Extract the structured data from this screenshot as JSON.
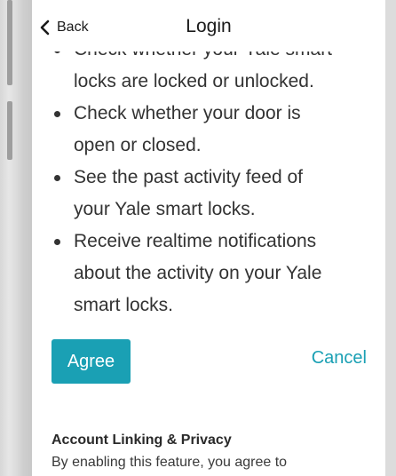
{
  "header": {
    "back_label": "Back",
    "title": "Login"
  },
  "content": {
    "bullets": [
      "Check whether your Yale smart locks are locked or unlocked.",
      "Check whether your door is open or closed.",
      "See the past activity feed of your Yale smart locks.",
      "Receive realtime notifications about the activity on your Yale smart locks."
    ],
    "bullet_lines": [
      [
        "Check whether your Yale smart",
        "locks are locked or unlocked."
      ],
      [
        "Check whether your door is",
        "open or closed."
      ],
      [
        "See the past activity feed of",
        "your Yale smart locks."
      ],
      [
        "Receive realtime notifications",
        "about the activity on your Yale",
        "smart locks."
      ]
    ]
  },
  "actions": {
    "agree_label": "Agree",
    "cancel_label": "Cancel"
  },
  "privacy": {
    "title": "Account Linking & Privacy",
    "text": "By enabling this feature, you agree to"
  },
  "colors": {
    "accent": "#1aa0b4",
    "text": "#333333",
    "background": "#ffffff"
  },
  "icons": {
    "back": "chevron-left-icon"
  }
}
